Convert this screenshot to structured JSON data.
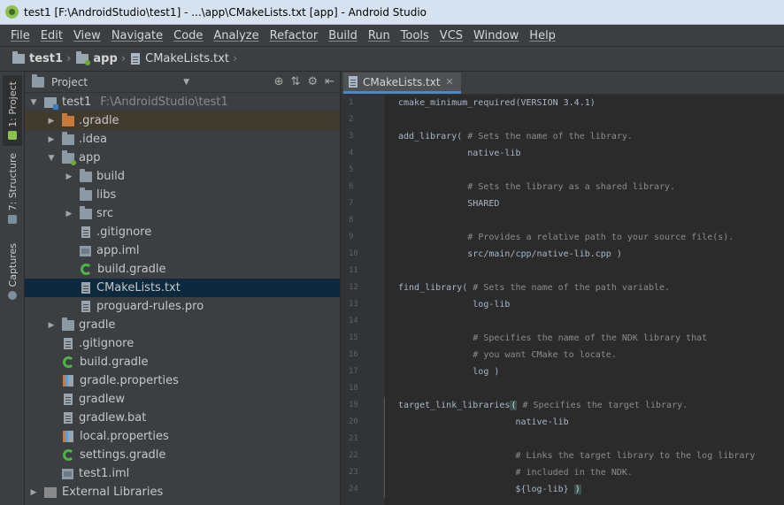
{
  "window": {
    "title": "test1 [F:\\AndroidStudio\\test1] - ...\\app\\CMakeLists.txt [app] - Android Studio"
  },
  "menu": [
    "File",
    "Edit",
    "View",
    "Navigate",
    "Code",
    "Analyze",
    "Refactor",
    "Build",
    "Run",
    "Tools",
    "VCS",
    "Window",
    "Help"
  ],
  "breadcrumb": [
    "test1",
    "app",
    "CMakeLists.txt"
  ],
  "side_tabs": {
    "project": "1: Project",
    "structure": "7: Structure",
    "captures": "Captures"
  },
  "project_panel": {
    "view_selector": "Project",
    "tree": [
      {
        "label": "test1",
        "path": "F:\\AndroidStudio\\test1"
      },
      {
        "label": ".gradle"
      },
      {
        "label": ".idea"
      },
      {
        "label": "app"
      },
      {
        "label": "build"
      },
      {
        "label": "libs"
      },
      {
        "label": "src"
      },
      {
        "label": ".gitignore"
      },
      {
        "label": "app.iml"
      },
      {
        "label": "build.gradle"
      },
      {
        "label": "CMakeLists.txt"
      },
      {
        "label": "proguard-rules.pro"
      },
      {
        "label": "gradle"
      },
      {
        "label": ".gitignore"
      },
      {
        "label": "build.gradle"
      },
      {
        "label": "gradle.properties"
      },
      {
        "label": "gradlew"
      },
      {
        "label": "gradlew.bat"
      },
      {
        "label": "local.properties"
      },
      {
        "label": "settings.gradle"
      },
      {
        "label": "test1.iml"
      },
      {
        "label": "External Libraries"
      }
    ]
  },
  "editor": {
    "tab_label": "CMakeLists.txt",
    "line_numbers": [
      "1",
      "2",
      "3",
      "4",
      "5",
      "6",
      "7",
      "8",
      "9",
      "10",
      "11",
      "12",
      "13",
      "14",
      "15",
      "16",
      "17",
      "18",
      "19",
      "20",
      "21",
      "22",
      "23",
      "24"
    ],
    "lines": [
      {
        "code": "cmake_minimum_required(VERSION 3.4.1)",
        "comment": ""
      },
      {
        "code": "",
        "comment": ""
      },
      {
        "code": "add_library( ",
        "comment": "# Sets the name of the library."
      },
      {
        "code": "             native-lib",
        "comment": ""
      },
      {
        "code": "",
        "comment": ""
      },
      {
        "code": "             ",
        "comment": "# Sets the library as a shared library."
      },
      {
        "code": "             SHARED",
        "comment": ""
      },
      {
        "code": "",
        "comment": ""
      },
      {
        "code": "             ",
        "comment": "# Provides a relative path to your source file(s)."
      },
      {
        "code": "             src/main/cpp/native-lib.cpp )",
        "comment": ""
      },
      {
        "code": "",
        "comment": ""
      },
      {
        "code": "find_library( ",
        "comment": "# Sets the name of the path variable."
      },
      {
        "code": "              log-lib",
        "comment": ""
      },
      {
        "code": "",
        "comment": ""
      },
      {
        "code": "              ",
        "comment": "# Specifies the name of the NDK library that"
      },
      {
        "code": "              ",
        "comment": "# you want CMake to locate."
      },
      {
        "code": "              log )",
        "comment": ""
      },
      {
        "code": "",
        "comment": ""
      },
      {
        "code": "target_link_libraries",
        "paren": "(",
        "comment": " # Specifies the target library."
      },
      {
        "code": "                      native-lib",
        "comment": ""
      },
      {
        "code": "",
        "comment": ""
      },
      {
        "code": "                      ",
        "comment": "# Links the target library to the log library"
      },
      {
        "code": "                      ",
        "comment": "# included in the NDK."
      },
      {
        "code": "                      ${log-lib} ",
        "paren": ")",
        "comment": ""
      }
    ]
  }
}
